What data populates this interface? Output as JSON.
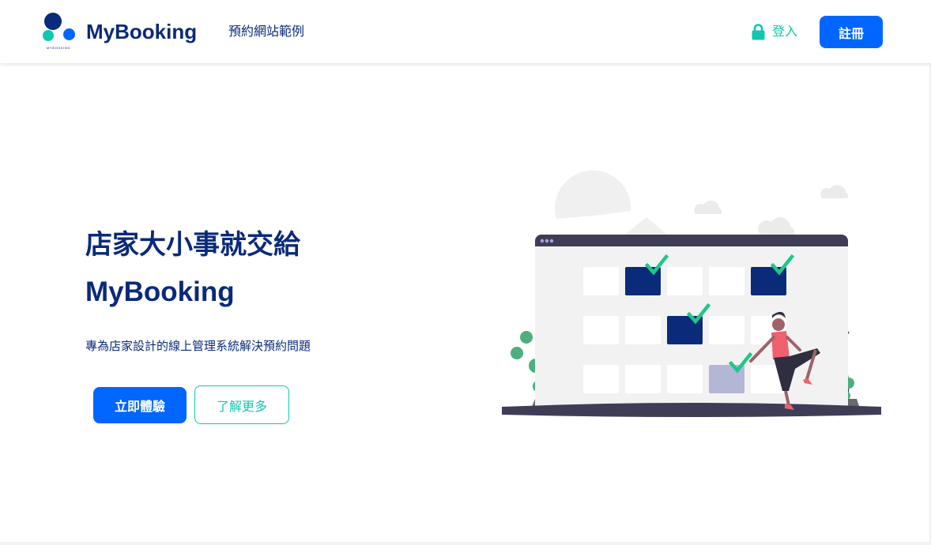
{
  "colors": {
    "navy": "#0a2a7a",
    "blue": "#0066ff",
    "teal": "#10c7b0",
    "green": "#1cc88a",
    "slate": "#3f3d56",
    "lavender": "#b3b6d4",
    "pink": "#f0606e"
  },
  "header": {
    "logo_icon": "mybooking-logo",
    "logo_small_text": "MYBOOKING",
    "brand": "MyBooking",
    "nav_link": "預約網站範例",
    "login_icon": "lock-icon",
    "login_label": "登入",
    "signup_label": "註冊"
  },
  "hero": {
    "title_line1": "店家大小事就交給",
    "title_line2": "MyBooking",
    "subtitle": "專為店家設計的線上管理系統解決預約問題",
    "primary_button": "立即體驗",
    "secondary_button": "了解更多"
  },
  "illustration": {
    "name": "calendar-booking-illustration",
    "calendar_rows": [
      [
        "empty",
        "booked",
        "empty",
        "empty",
        "booked"
      ],
      [
        "empty",
        "empty",
        "booked",
        "empty",
        "empty"
      ],
      [
        "empty",
        "empty",
        "empty",
        "selected",
        "empty"
      ]
    ]
  }
}
